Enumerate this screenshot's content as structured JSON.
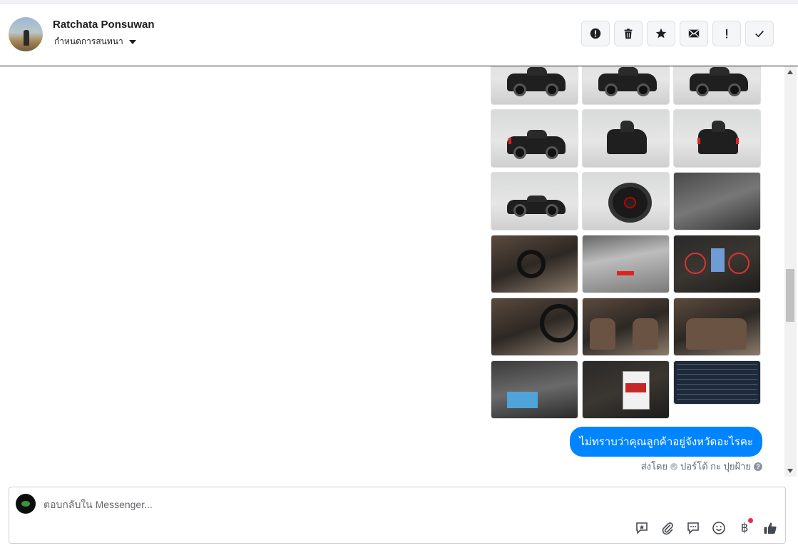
{
  "header": {
    "contact_name": "Ratchata Ponsuwan",
    "assign_label": "กำหนดการสนทนา",
    "actions": [
      {
        "name": "spam-button",
        "icon": "alert-circle-icon"
      },
      {
        "name": "delete-button",
        "icon": "trash-icon"
      },
      {
        "name": "star-button",
        "icon": "star-icon"
      },
      {
        "name": "mark-unread-button",
        "icon": "envelope-icon"
      },
      {
        "name": "follow-up-button",
        "icon": "exclamation-icon"
      },
      {
        "name": "mark-done-button",
        "icon": "check-icon"
      }
    ]
  },
  "thread": {
    "photo_count": 18,
    "message_text": "ไม่ทราบว่าคุณลูกค้าอยู่จังหวัดอะไรคะ",
    "sent_by_label": "ส่งโดย",
    "sender_name": "ปอร์โต้ กะ ปุยฝ้าย",
    "message_color": "#0084ff"
  },
  "composer": {
    "placeholder": "ตอบกลับใน Messenger...",
    "tools": [
      "saved-reply-icon",
      "paperclip-icon",
      "chat-bubble-icon",
      "emoji-icon",
      "baht-icon",
      "thumbs-up-icon"
    ],
    "baht_symbol": "฿"
  }
}
